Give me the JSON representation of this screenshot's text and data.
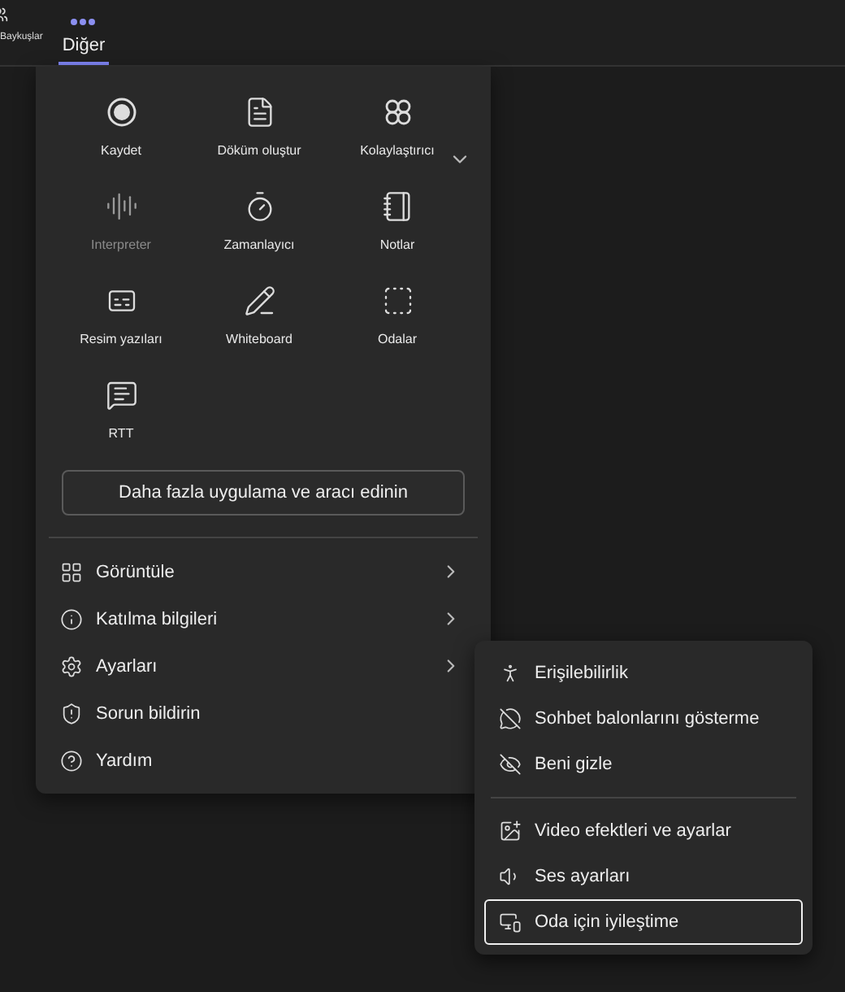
{
  "top_bar": {
    "left_label": "Baykuşlar",
    "tabs": [
      {
        "label": "Diğer",
        "selected": true
      }
    ]
  },
  "apps_menu": {
    "apps": [
      {
        "label": "Kaydet",
        "disabled": false
      },
      {
        "label": "Döküm oluştur",
        "disabled": false
      },
      {
        "label": "Kolaylaştırıcı",
        "disabled": false
      },
      {
        "label": "Interpreter",
        "disabled": true
      },
      {
        "label": "Zamanlayıcı",
        "disabled": false
      },
      {
        "label": "Notlar",
        "disabled": false
      },
      {
        "label": "Resim yazıları",
        "disabled": false
      },
      {
        "label": "Whiteboard",
        "disabled": false
      },
      {
        "label": "Odalar",
        "disabled": false
      },
      {
        "label": "RTT",
        "disabled": false
      }
    ],
    "more_apps_button": "Daha fazla uygulama ve aracı edinin",
    "items": [
      {
        "label": "Görüntüle",
        "has_submenu": true
      },
      {
        "label": "Katılma bilgileri",
        "has_submenu": true
      },
      {
        "label": "Ayarları",
        "has_submenu": true
      },
      {
        "label": "Sorun bildirin",
        "has_submenu": false
      },
      {
        "label": "Yardım",
        "has_submenu": false
      }
    ]
  },
  "settings_submenu": {
    "groups": [
      [
        {
          "label": "Erişilebilirlik",
          "focused": false
        },
        {
          "label": "Sohbet balonlarını gösterme",
          "focused": false
        },
        {
          "label": "Beni gizle",
          "focused": false
        }
      ],
      [
        {
          "label": "Video efektleri ve ayarlar",
          "focused": false
        },
        {
          "label": "Ses ayarları",
          "focused": false
        },
        {
          "label": "Oda için iyileştime",
          "focused": true
        }
      ]
    ]
  }
}
